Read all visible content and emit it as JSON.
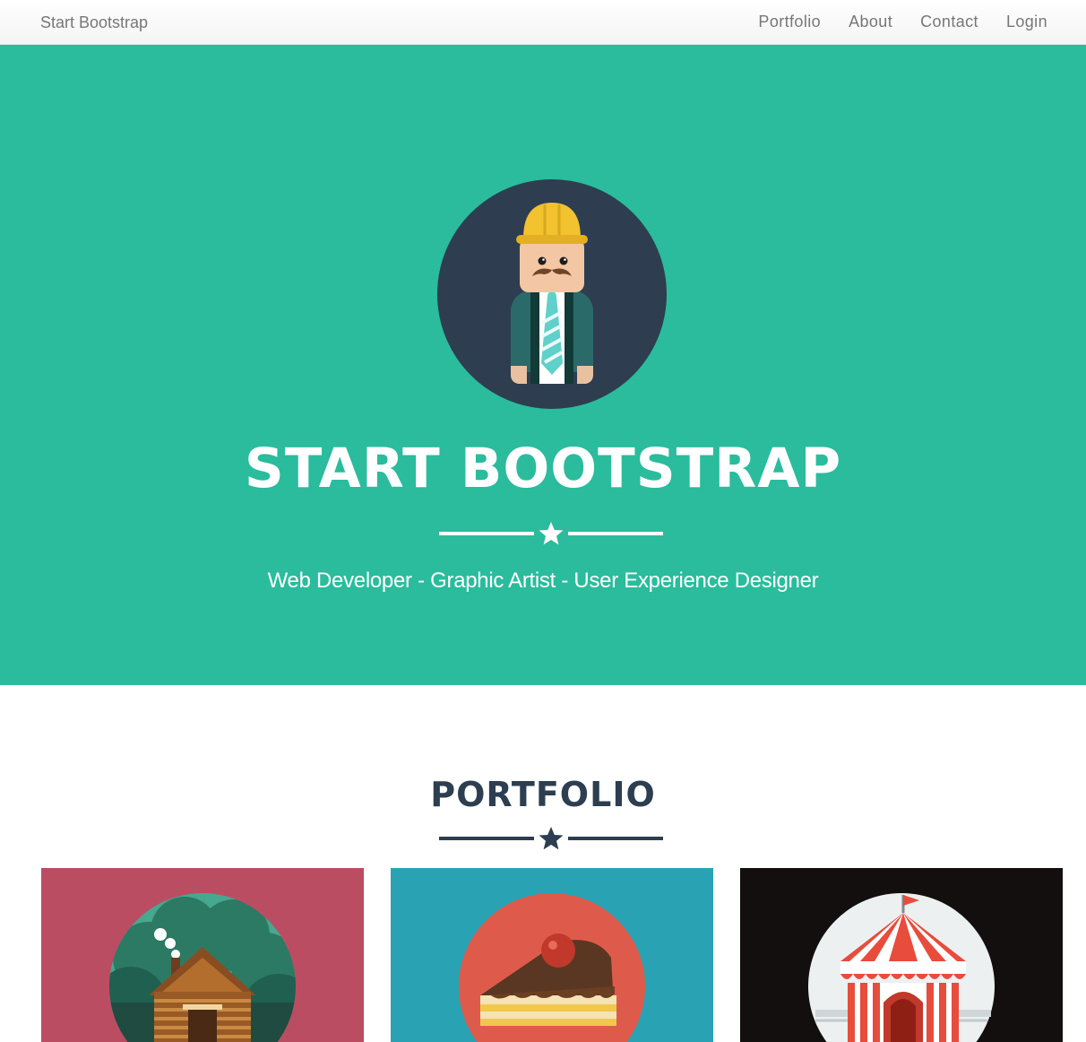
{
  "navbar": {
    "brand": "Start Bootstrap",
    "links": [
      "Portfolio",
      "About",
      "Contact",
      "Login"
    ]
  },
  "header": {
    "title": "START BOOTSTRAP",
    "skills": "Web Developer - Graphic Artist - User Experience Designer",
    "background_color": "#2abc9c",
    "avatar_icon": "construction-worker-avatar"
  },
  "portfolio": {
    "title": "PORTFOLIO",
    "accent_color": "#2c3e50",
    "items": [
      {
        "icon": "cabin-icon",
        "background_color": "#bb4d63"
      },
      {
        "icon": "cake-icon",
        "background_color": "#29a3b4"
      },
      {
        "icon": "circus-tent-icon",
        "background_color": "#130f0e"
      }
    ]
  },
  "colors": {
    "nav_text": "#777777",
    "heading_dark": "#2c3e50",
    "white": "#ffffff"
  }
}
